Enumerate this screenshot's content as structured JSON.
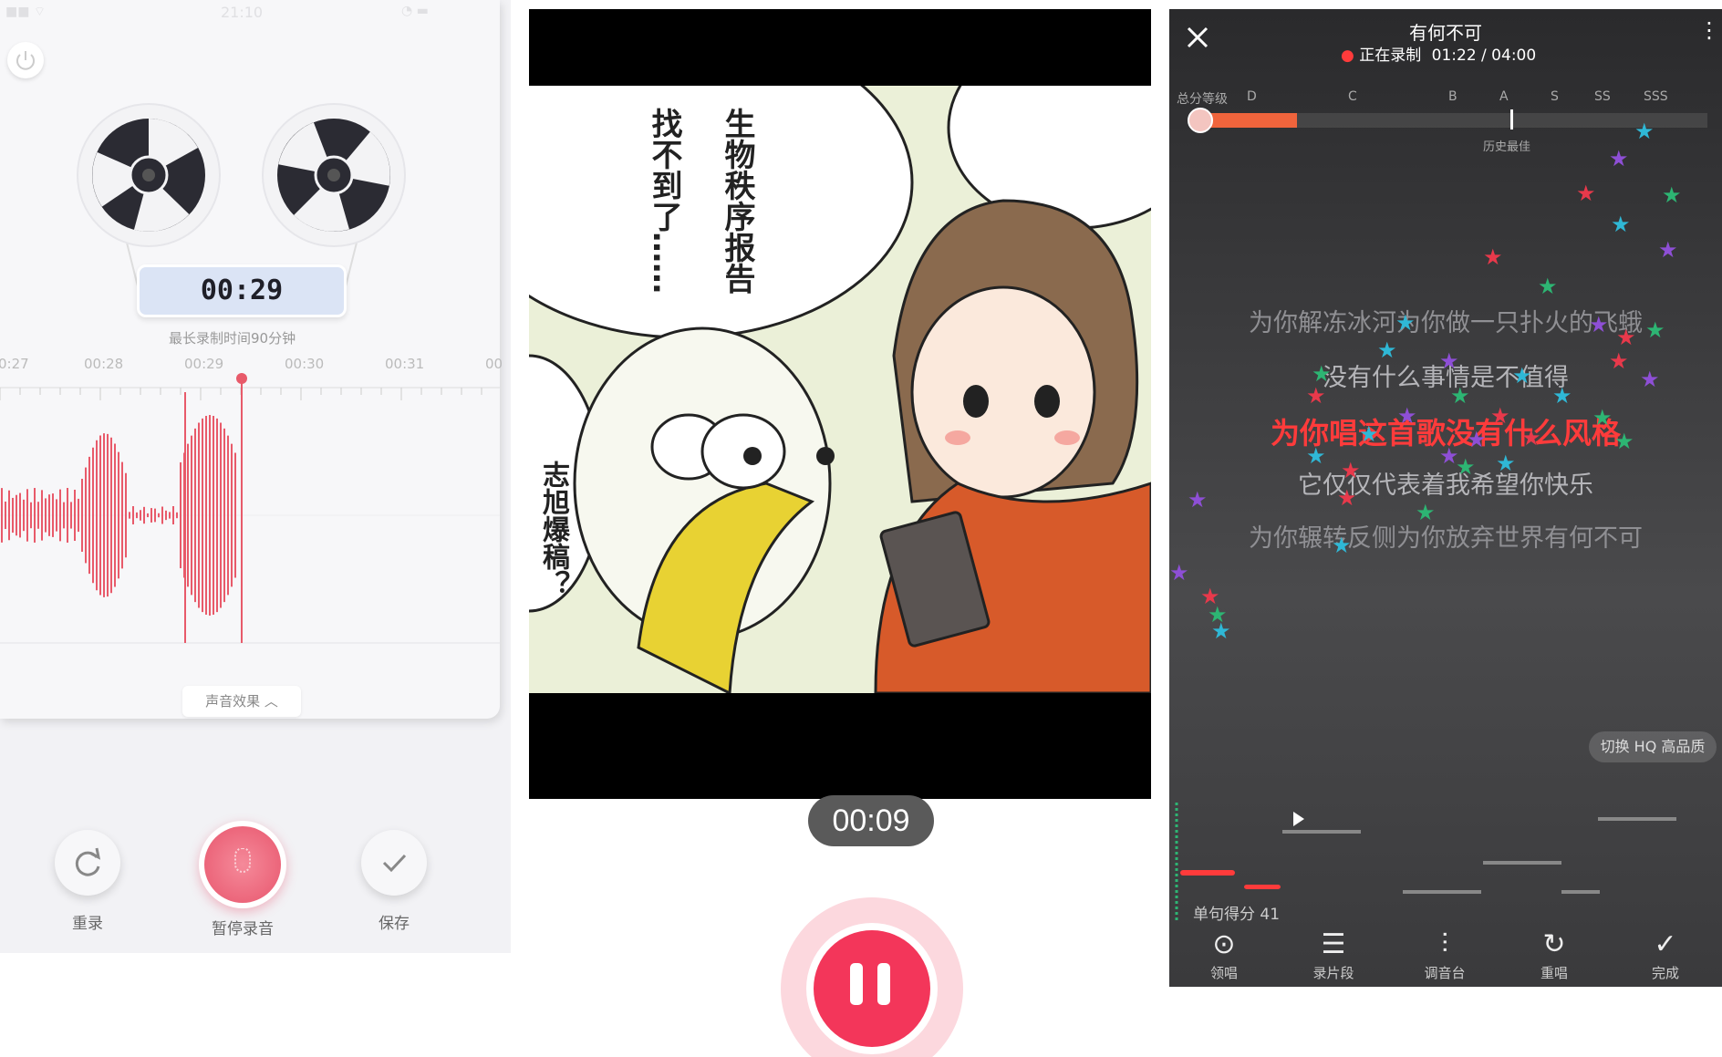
{
  "recorder": {
    "status_left": "■■ ⌔",
    "status_time": "21:10",
    "status_right": "◔ ▬",
    "time": "00:29",
    "max_text": "最长录制时间90分钟",
    "ticks": [
      "0:27",
      "00:28",
      "00:29",
      "00:30",
      "00:31",
      "00"
    ],
    "effects_label": "声音效果 ︿",
    "rerecord_label": "重录",
    "pause_label": "暂停录音",
    "save_label": "保存"
  },
  "video": {
    "bubble1": "生物秩序报告",
    "bubble2": "找不到了……",
    "bubble3": "志旭爆稿？",
    "time": "00:09",
    "accent": "#f3365a"
  },
  "karaoke": {
    "song_title": "有何不可",
    "recording_status": "正在录制",
    "progress": "01:22 / 04:00",
    "grade_label": "总分等级",
    "grades": [
      "D",
      "C",
      "B",
      "A",
      "S",
      "SS",
      "SSS"
    ],
    "best_label": "历史最佳",
    "lyrics": [
      "为你解冻冰河为你做一只扑火的飞蛾",
      "没有什么事情是不值得",
      "为你唱这首歌没有什么风格",
      "它仅仅代表着我希望你快乐",
      "为你辗转反侧为你放弃世界有何不可"
    ],
    "hq_label": "切换 HQ 高品质",
    "line_score": "单句得分 41",
    "tools": [
      {
        "icon": "⊙",
        "label": "领唱"
      },
      {
        "icon": "☰",
        "label": "录片段"
      },
      {
        "icon": "⫶",
        "label": "调音台"
      },
      {
        "icon": "↻",
        "label": "重唱"
      },
      {
        "icon": "✓",
        "label": "完成"
      }
    ],
    "highlight_color": "#ff3b3b",
    "star_colors": [
      "#2fb8d6",
      "#8e4fd6",
      "#e8394b",
      "#2db573"
    ]
  }
}
